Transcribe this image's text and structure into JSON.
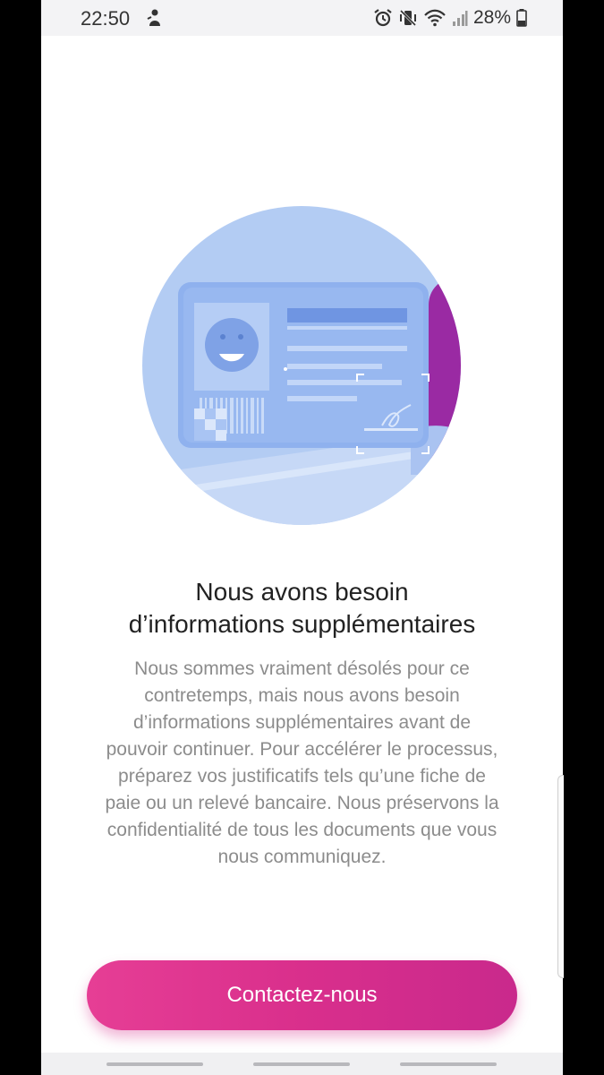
{
  "status_bar": {
    "time": "22:50",
    "battery": "28%",
    "icons": [
      "notification-icon",
      "alarm-icon",
      "vibrate-icon",
      "wifi-icon",
      "signal-icon",
      "battery-icon"
    ]
  },
  "illustration": {
    "icon": "id-card-scan-illustration",
    "colors": {
      "circle": "#b3ccf3",
      "card": "#8fb1ee",
      "accent": "#9a2aa3"
    }
  },
  "content": {
    "title_lines": [
      "Nous avons besoin",
      "d’informations supplémentaires"
    ],
    "description_lines": [
      "Nous sommes vraiment désolés pour ce",
      "contretemps, mais nous avons besoin",
      "d’informations supplémentaires avant de",
      "pouvoir continuer. Pour accélérer le processus,",
      "préparez vos justificatifs tels qu’une fiche de",
      "paie ou un relevé bancaire. Nous préservons la",
      "confidentialité de tous les documents que vous",
      "nous communiquez."
    ]
  },
  "actions": {
    "contact_label": "Contactez-nous",
    "accent_color": "#d92f8c"
  }
}
